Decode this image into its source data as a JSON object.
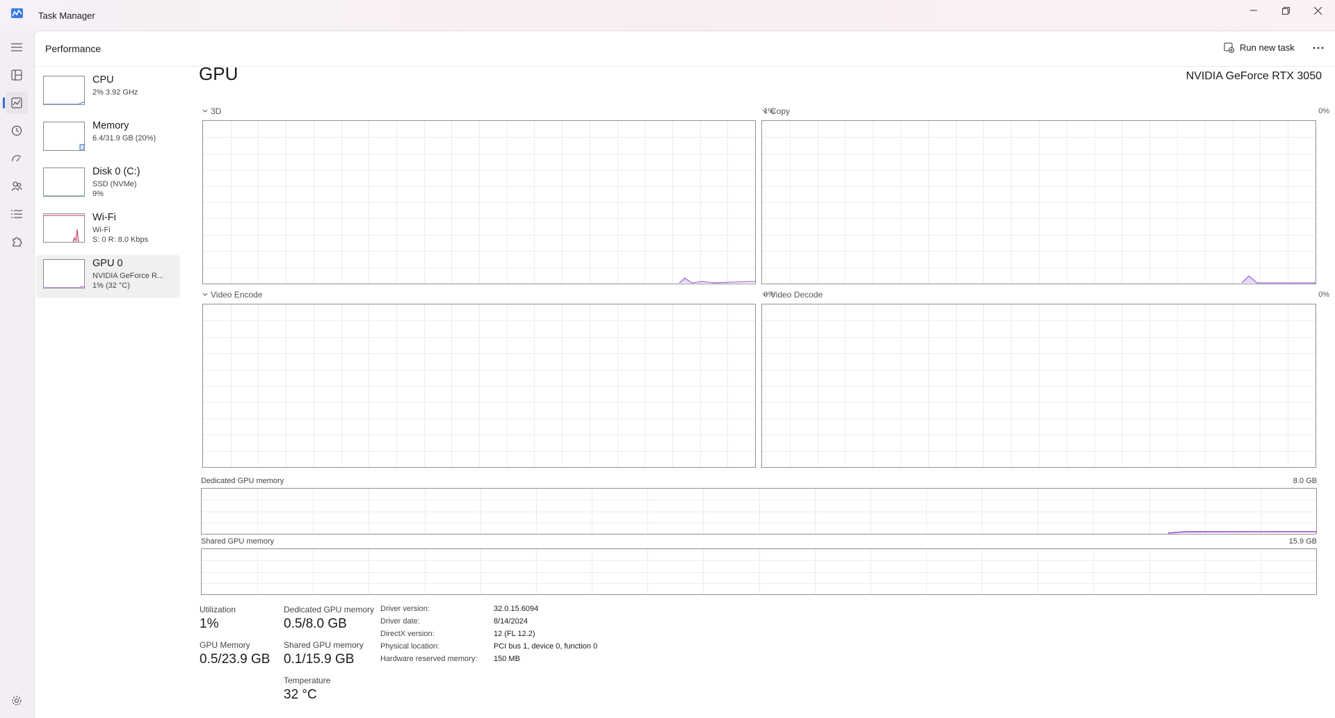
{
  "app": {
    "title": "Task Manager"
  },
  "header": {
    "title": "Performance",
    "run_new_task": "Run new task"
  },
  "devices": [
    {
      "name": "CPU",
      "line1": "2% 3.92 GHz",
      "line2": ""
    },
    {
      "name": "Memory",
      "line1": "6.4/31.9 GB (20%)",
      "line2": ""
    },
    {
      "name": "Disk 0 (C:)",
      "line1": "SSD (NVMe)",
      "line2": "9%"
    },
    {
      "name": "Wi-Fi",
      "line1": "Wi-Fi",
      "line2": "S: 0 R: 8.0 Kbps"
    },
    {
      "name": "GPU 0",
      "line1": "NVIDIA GeForce R...",
      "line2": "1% (32 °C)"
    }
  ],
  "gpu": {
    "title": "GPU",
    "model": "NVIDIA GeForce RTX 3050",
    "graphs": [
      {
        "label": "3D",
        "percent": "1%"
      },
      {
        "label": "Copy",
        "percent": "0%"
      },
      {
        "label": "Video Encode",
        "percent": "0%"
      },
      {
        "label": "Video Decode",
        "percent": "0%"
      }
    ],
    "dedicated_memory": {
      "label": "Dedicated GPU memory",
      "max": "8.0 GB"
    },
    "shared_memory": {
      "label": "Shared GPU memory",
      "max": "15.9 GB"
    },
    "stats": {
      "utilization_label": "Utilization",
      "utilization": "1%",
      "dedicated_label": "Dedicated GPU memory",
      "dedicated": "0.5/8.0 GB",
      "gpu_memory_label": "GPU Memory",
      "gpu_memory": "0.5/23.9 GB",
      "shared_label": "Shared GPU memory",
      "shared": "0.1/15.9 GB",
      "temperature_label": "Temperature",
      "temperature": "32 °C"
    },
    "info": [
      {
        "label": "Driver version:",
        "value": "32.0.15.6094"
      },
      {
        "label": "Driver date:",
        "value": "8/14/2024"
      },
      {
        "label": "DirectX version:",
        "value": "12 (FL 12.2)"
      },
      {
        "label": "Physical location:",
        "value": "PCI bus 1, device 0, function 0"
      },
      {
        "label": "Hardware reserved memory:",
        "value": "150 MB"
      }
    ]
  },
  "colors": {
    "gpu_line": "#8e44d9",
    "wifi_line": "#c0396b",
    "accent": "#2f6fd1"
  }
}
